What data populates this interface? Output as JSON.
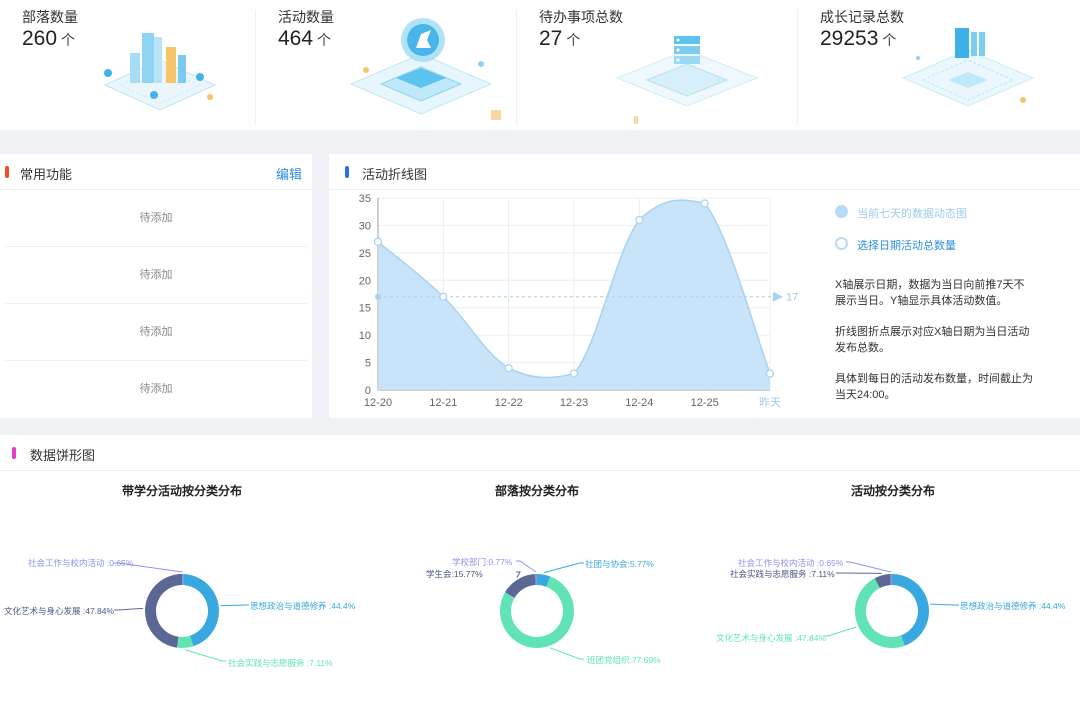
{
  "stats": [
    {
      "label": "部落数量",
      "value": "260",
      "unit": "个",
      "icon": "city-illustration-icon"
    },
    {
      "label": "活动数量",
      "value": "464",
      "unit": "个",
      "icon": "unicorn-platform-illustration-icon"
    },
    {
      "label": "待办事项总数",
      "value": "27",
      "unit": "个",
      "icon": "server-illustration-icon"
    },
    {
      "label": "成长记录总数",
      "value": "29253",
      "unit": "个",
      "icon": "document-illustration-icon"
    }
  ],
  "functions_panel": {
    "title": "常用功能",
    "edit_label": "编辑",
    "accent": "#f04b24",
    "items": [
      "待添加",
      "待添加",
      "待添加",
      "待添加"
    ]
  },
  "line_panel": {
    "title": "活动折线图",
    "accent": "#2e6fe0",
    "legend": [
      {
        "label": "当前七天的数据动态图",
        "filled": true
      },
      {
        "label": "选择日期活动总数量",
        "filled": false
      }
    ],
    "notes": [
      "X轴展示日期，数据为当日向前推7天不展示当日。Y轴显示具体活动数值。",
      "折线图折点展示对应X轴日期为当日活动发布总数。",
      "具体到每日的活动发布数量，时间截止为当天24:00。"
    ],
    "markline_label": "17"
  },
  "chart_data": [
    {
      "type": "area",
      "title": "",
      "categories": [
        "12-20",
        "12-21",
        "12-22",
        "12-23",
        "12-24",
        "12-25",
        "昨天"
      ],
      "values": [
        27,
        17,
        4,
        3,
        31,
        34,
        3
      ],
      "ylim": [
        0,
        35
      ],
      "yticks": [
        0,
        5,
        10,
        15,
        20,
        25,
        30,
        35
      ],
      "markline": 17,
      "grid": true,
      "color": "#9ccbf2"
    },
    {
      "type": "pie",
      "title": "带学分活动按分类分布",
      "slices": [
        {
          "label": "社会工作与校内活动",
          "value": 0.65,
          "text": "社会工作与校内活动 :0.65%",
          "color": "#8d93f0"
        },
        {
          "label": "思想政治与道德修养",
          "value": 44.4,
          "text": "思想政治与道德修养 :44.4%",
          "color": "#3aa8e0"
        },
        {
          "label": "社会实践与志愿服务",
          "value": 7.11,
          "text": "社会实践与志愿服务 :7.11%",
          "color": "#62e3b6"
        },
        {
          "label": "文化艺术与身心发展",
          "value": 47.84,
          "text": "文化艺术与身心发展 :47.84%",
          "color": "#5c6893"
        }
      ]
    },
    {
      "type": "pie",
      "title": "部落按分类分布",
      "slices": [
        {
          "label": "社团与协会",
          "value": 5.77,
          "text": "社团与协会:5.77%",
          "color": "#3aa8e0"
        },
        {
          "label": "班团党组织",
          "value": 77.69,
          "text": "班团党组织:77.69%",
          "color": "#62e3b6"
        },
        {
          "label": "学生会",
          "value": 15.77,
          "text": "学生会:15.77%",
          "color": "#5c6893"
        },
        {
          "label": "学校部门",
          "value": 0.77,
          "text": "学校部门:0.77%",
          "color": "#8d93f0"
        }
      ]
    },
    {
      "type": "pie",
      "title": "活动按分类分布",
      "slices": [
        {
          "label": "思想政治与道德修养",
          "value": 44.4,
          "text": "思想政治与道德修养 :44.4%",
          "color": "#3aa8e0"
        },
        {
          "label": "文化艺术与身心发展",
          "value": 47.84,
          "text": "文化艺术与身心发展 :47.84%",
          "color": "#62e3b6"
        },
        {
          "label": "社会实践与志愿服务",
          "value": 7.11,
          "text": "社会实践与志愿服务 :7.11%",
          "color": "#5c6893"
        },
        {
          "label": "社会工作与校内活动",
          "value": 0.65,
          "text": "社会工作与校内活动 :0.65%",
          "color": "#8d93f0"
        }
      ]
    }
  ],
  "pie_panel": {
    "title": "数据饼形图",
    "accent": "#e63cc8"
  }
}
